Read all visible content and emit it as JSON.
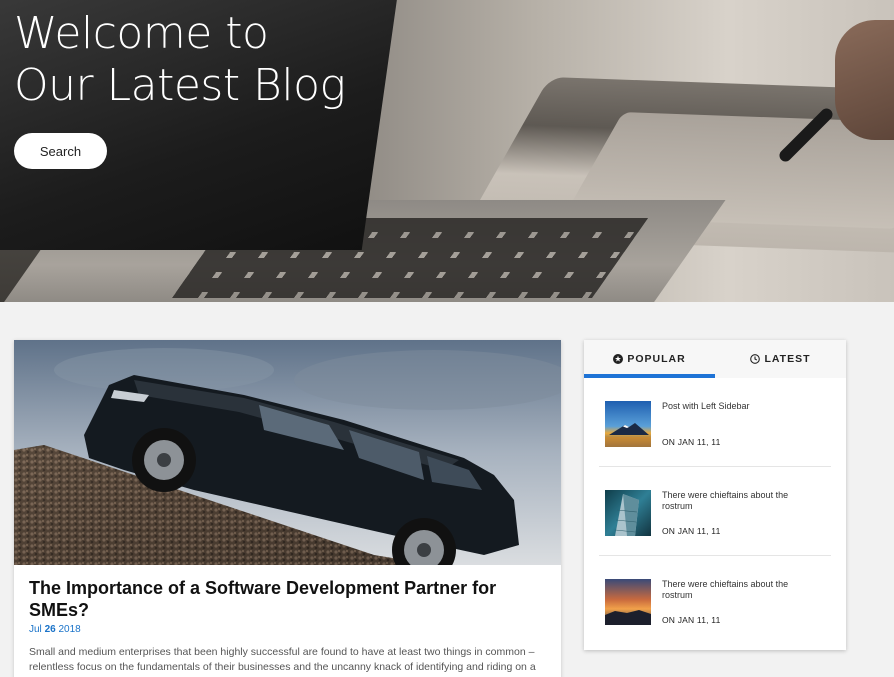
{
  "hero": {
    "title_line1": "Welcome to",
    "title_line2": "Our Latest Blog",
    "search_label": "Search"
  },
  "post": {
    "title": "The Importance of a Software Development Partner for SMEs?",
    "date_month": "Jul",
    "date_day": "26",
    "date_year": "2018",
    "excerpt": "Small and medium enterprises that been highly successful are found to have at least two things in common – relentless focus on the fundamentals of their businesses and the uncanny knack of identifying and riding on a market/technological wave. There is also another common thread that connects them all, one witnessing an exponential rise in its relevance – 'Information Technology' as an enabler. Not surprisingly, the one question"
  },
  "sidebar": {
    "tabs": [
      {
        "label": "POPULAR",
        "icon": "star-circle-icon",
        "active": true
      },
      {
        "label": "LATEST",
        "icon": "clock-icon",
        "active": false
      }
    ],
    "items": [
      {
        "title": "Post with Left Sidebar",
        "date": "ON JAN 11, 11",
        "thumb": "mountain-sunset-thumb"
      },
      {
        "title": "There were chieftains about the rostrum",
        "date": "ON JAN 11, 11",
        "thumb": "building-thumb"
      },
      {
        "title": "There were chieftains about the rostrum",
        "date": "ON JAN 11, 11",
        "thumb": "sunset-sea-thumb"
      }
    ]
  },
  "colors": {
    "accent": "#1e73d6",
    "date_link": "#1a73c9",
    "background": "#f2f2f2"
  }
}
